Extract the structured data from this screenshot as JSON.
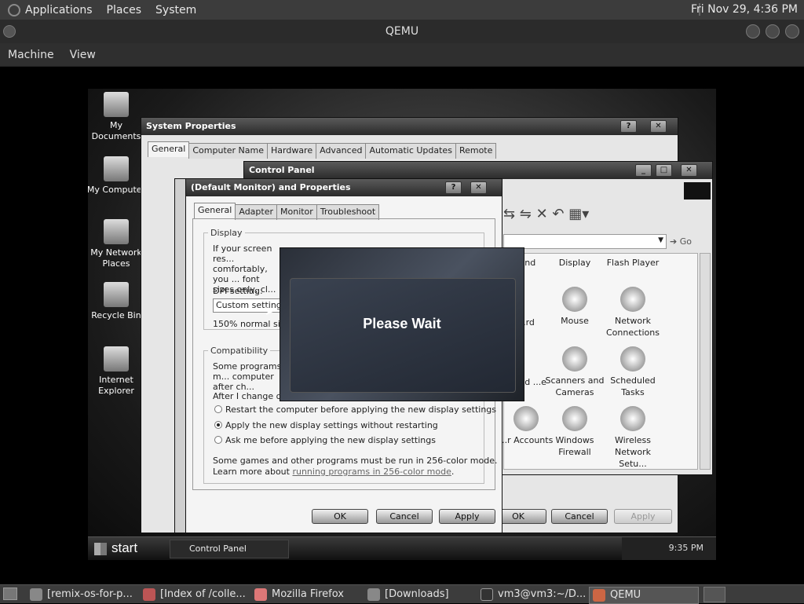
{
  "host_panel": {
    "menus": [
      "Applications",
      "Places",
      "System"
    ],
    "clock": "Fri Nov 29,  4:36 PM"
  },
  "qemu": {
    "title": "QEMU",
    "menu": [
      "Machine",
      "View"
    ]
  },
  "desktop_icons": [
    {
      "label": "My Documents"
    },
    {
      "label": "My Computer"
    },
    {
      "label": "My Network Places"
    },
    {
      "label": "Recycle Bin"
    },
    {
      "label": "Internet Explorer"
    }
  ],
  "sysprops": {
    "title": "System Properties",
    "tabs": [
      "General",
      "Computer Name",
      "Hardware",
      "Advanced",
      "Automatic Updates",
      "Remote"
    ]
  },
  "control_panel": {
    "title": "Control Panel",
    "go": "Go",
    "items": [
      {
        "label": "...nd"
      },
      {
        "label": "Display"
      },
      {
        "label": "Flash Player"
      },
      {
        "label": "...rd"
      },
      {
        "label": "Mouse"
      },
      {
        "label": "Network Connections"
      },
      {
        "label": "...and ...e"
      },
      {
        "label": "Scanners and Cameras"
      },
      {
        "label": "Scheduled Tasks"
      },
      {
        "label": "...r Accounts"
      },
      {
        "label": "Windows Firewall"
      },
      {
        "label": "Wireless Network Setu..."
      }
    ],
    "buttons": {
      "ok": "OK",
      "cancel": "Cancel",
      "apply": "Apply"
    }
  },
  "display_props": {
    "title": "(Default Monitor) and  Properties",
    "tabs": [
      "General",
      "Adapter",
      "Monitor",
      "Troubleshoot"
    ],
    "display_group": "Display",
    "display_text": "If your screen res... comfortably, you ... font sizes only, cl...",
    "dpi_label": "DPI setting:",
    "dpi_value": "Custom setting",
    "dpi_note": "150% normal size",
    "compat_group": "Compatibility",
    "compat_text": "Some programs m... computer after ch...",
    "after_change": "After I change display settings:",
    "radios": [
      {
        "label": "Restart the computer before applying the new display settings",
        "selected": false
      },
      {
        "label": "Apply the new display settings without restarting",
        "selected": true
      },
      {
        "label": "Ask me before applying the new display settings",
        "selected": false
      }
    ],
    "note_line1": "Some games and other programs must be run in 256-color mode.",
    "note_prefix": "Learn more about ",
    "note_link": "running programs in 256-color mode",
    "note_suffix": ".",
    "buttons": {
      "ok": "OK",
      "cancel": "Cancel",
      "apply": "Apply"
    }
  },
  "please_wait": "Please Wait",
  "guest_taskbar": {
    "start": "start",
    "item": "Control Panel",
    "time": "9:35 PM"
  },
  "host_taskbar": [
    {
      "label": "[remix-os-for-p..."
    },
    {
      "label": "[Index of /colle..."
    },
    {
      "label": "Mozilla Firefox"
    },
    {
      "label": "[Downloads]"
    },
    {
      "label": "vm3@vm3:~/D..."
    },
    {
      "label": "QEMU"
    }
  ]
}
